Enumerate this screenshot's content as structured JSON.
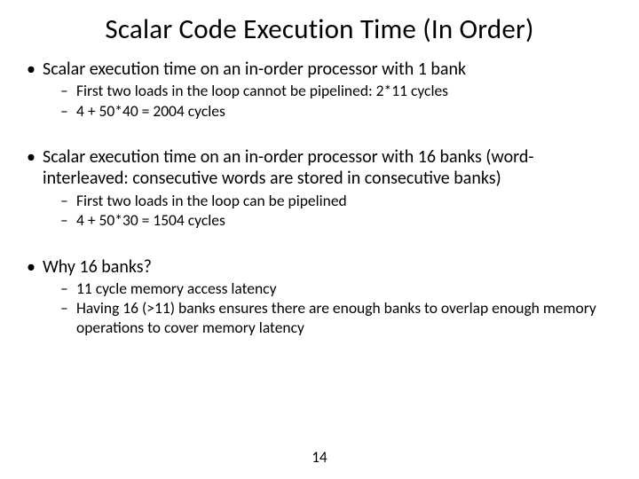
{
  "title": "Scalar Code Execution Time (In Order)",
  "sections": [
    {
      "text": "Scalar execution time on an in-order processor with 1 bank",
      "subs": [
        "First two loads in the loop cannot be pipelined: 2*11 cycles",
        "4 + 50*40 = 2004 cycles"
      ]
    },
    {
      "text": "Scalar execution time on an in-order processor with 16 banks (word-interleaved: consecutive words are stored in consecutive banks)",
      "subs": [
        "First two loads in the loop can be pipelined",
        "4 + 50*30 = 1504 cycles"
      ]
    },
    {
      "text": "Why 16 banks?",
      "subs": [
        "11 cycle memory access latency",
        "Having 16 (>11) banks ensures there are enough banks to overlap enough memory operations to cover memory latency"
      ]
    }
  ],
  "page_number": "14"
}
